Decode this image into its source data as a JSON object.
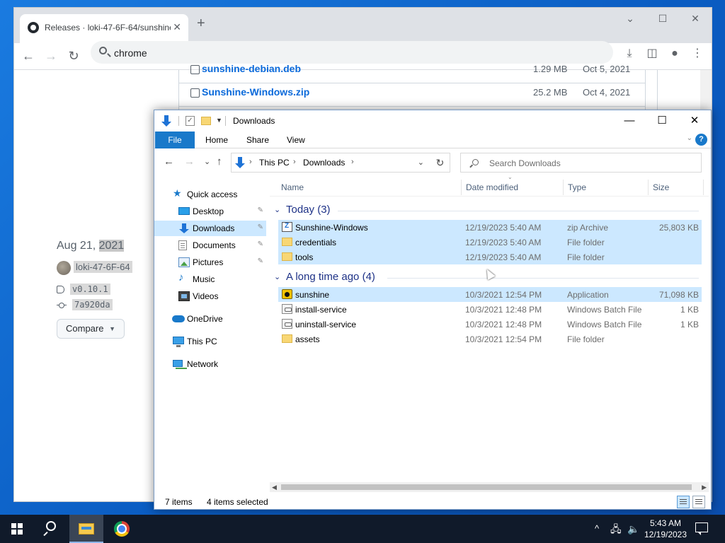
{
  "chrome": {
    "tab_title": "Releases · loki-47-6F-64/sunshine",
    "tab_close": "✕",
    "new_tab": "+",
    "caption_buttons": [
      "⌄",
      "☐",
      "✕"
    ],
    "back": "←",
    "forward": "→",
    "reload": "↻",
    "omnibox_text": "chrome",
    "toolbar_icons": [
      "download-icon",
      "sidebar-icon",
      "profile-icon",
      "menu-icon"
    ]
  },
  "github": {
    "assets": [
      {
        "name": "sunshine-debian.deb",
        "size": "1.29 MB",
        "date": "Oct 5, 2021"
      },
      {
        "name": "Sunshine-Windows.zip",
        "size": "25.2 MB",
        "date": "Oct 4, 2021"
      }
    ],
    "release_date_prefix": "Aug 21, ",
    "release_date_year": "2021",
    "author": "loki-47-6F-64",
    "tag": "v0.10.1",
    "commit": "7a920da",
    "compare_label": "Compare",
    "compare_caret": "▼"
  },
  "explorer": {
    "title": "Downloads",
    "caption_buttons": [
      "—",
      "☐",
      "✕"
    ],
    "ribbon": {
      "file": "File",
      "tabs": [
        "Home",
        "Share",
        "View"
      ],
      "help": "?",
      "chevron": "⌄"
    },
    "nav": {
      "back": "←",
      "forward": "→",
      "recent": "⌄",
      "up": "↑"
    },
    "address": {
      "crumbs": [
        "This PC",
        "Downloads"
      ],
      "separator": "›",
      "dropdown": "⌄",
      "refresh": "↻"
    },
    "search_placeholder": "Search Downloads",
    "nav_pane": [
      {
        "label": "Quick access",
        "icon": "star-icon"
      },
      {
        "label": "Desktop",
        "icon": "desktop-icon",
        "pinned": true
      },
      {
        "label": "Downloads",
        "icon": "download-icon",
        "pinned": true,
        "selected": true
      },
      {
        "label": "Documents",
        "icon": "documents-icon",
        "pinned": true
      },
      {
        "label": "Pictures",
        "icon": "pictures-icon",
        "pinned": true
      },
      {
        "label": "Music",
        "icon": "music-icon"
      },
      {
        "label": "Videos",
        "icon": "videos-icon"
      },
      {
        "label": "OneDrive",
        "icon": "cloud-icon"
      },
      {
        "label": "This PC",
        "icon": "computer-icon"
      },
      {
        "label": "Network",
        "icon": "network-icon"
      }
    ],
    "pin_glyph": "📌",
    "columns": [
      "Name",
      "Date modified",
      "Type",
      "Size"
    ],
    "groups": [
      {
        "label": "Today (3)",
        "chevron": "⌄",
        "files": [
          {
            "name": "Sunshine-Windows",
            "date": "12/19/2023 5:40 AM",
            "type": "zip Archive",
            "size": "25,803 KB",
            "icon": "zip-icon",
            "selected": true
          },
          {
            "name": "credentials",
            "date": "12/19/2023 5:40 AM",
            "type": "File folder",
            "size": "",
            "icon": "folder-icon",
            "selected": true
          },
          {
            "name": "tools",
            "date": "12/19/2023 5:40 AM",
            "type": "File folder",
            "size": "",
            "icon": "folder-icon",
            "selected": true
          }
        ]
      },
      {
        "label": "A long time ago (4)",
        "chevron": "⌄",
        "files": [
          {
            "name": "sunshine",
            "date": "10/3/2021 12:54 PM",
            "type": "Application",
            "size": "71,098 KB",
            "icon": "app-icon",
            "selected": true
          },
          {
            "name": "install-service",
            "date": "10/3/2021 12:48 PM",
            "type": "Windows Batch File",
            "size": "1 KB",
            "icon": "batch-file-icon",
            "selected": false
          },
          {
            "name": "uninstall-service",
            "date": "10/3/2021 12:48 PM",
            "type": "Windows Batch File",
            "size": "1 KB",
            "icon": "batch-file-icon",
            "selected": false
          },
          {
            "name": "assets",
            "date": "10/3/2021 12:54 PM",
            "type": "File folder",
            "size": "",
            "icon": "folder-icon",
            "selected": false
          }
        ]
      }
    ],
    "status": {
      "items": "7 items",
      "selected": "4 items selected"
    },
    "scroll": {
      "left": "◀",
      "right": "▶"
    }
  },
  "taskbar": {
    "tray": {
      "chevron": "^",
      "time": "5:43 AM",
      "date": "12/19/2023"
    }
  },
  "colors": {
    "selection": "#cce8ff",
    "file_tab": "#1979ca",
    "link": "#0969da",
    "taskbar": "#101a2a"
  }
}
